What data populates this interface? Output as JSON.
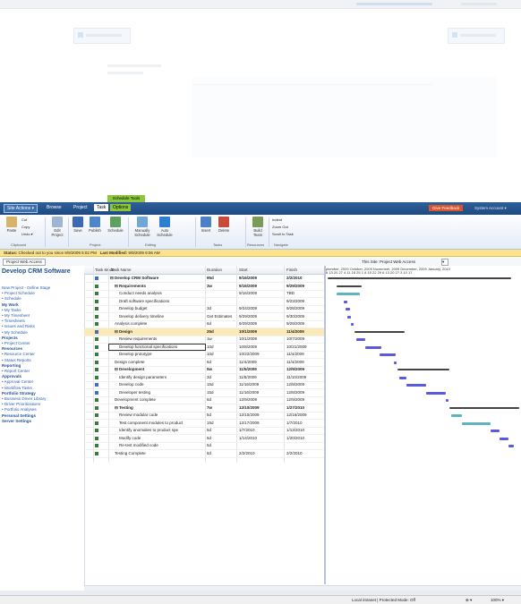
{
  "ribbon_tabs": {
    "site_actions": "Site Actions ▾",
    "browse": "Browse",
    "project": "Project",
    "task": "Task",
    "options": "Options",
    "context": "Schedule Tools",
    "feedback": "Give Feedback",
    "system": "System Account ▾"
  },
  "ribbon": {
    "paste": "Paste",
    "cut": "Cut",
    "copy": "Copy",
    "undo": "Undo ▾",
    "edit": "Edit Project",
    "save": "Save",
    "publish": "Publish",
    "schedule": "Schedule",
    "manual": "Manually Schedule",
    "auto": "Auto Schedule",
    "insert": "Insert",
    "delete": "Delete",
    "build_team": "Build Team",
    "indent": "Indent",
    "outdent": "Zoom Out",
    "scroll": "Scroll to Task",
    "groups": {
      "clipboard": "Clipboard",
      "project": "Project",
      "editing": "Editing",
      "tasks": "Tasks",
      "resources": "Resources",
      "navigate": "Navigate"
    }
  },
  "status": {
    "label": "Status:",
    "text": "Checked out to you since 9/9/2009 5:02 PM",
    "modified_label": "Last Modified:",
    "modified": "9/9/2009 9:06 AM"
  },
  "toolbar": {
    "project_web_access": "Project Web Access",
    "this_site": "This Site: Project Web Access",
    "search_value": "",
    "dropdown": "▾"
  },
  "leftnav": {
    "title": "Develop CRM Software",
    "items": [
      {
        "label": "New Project - Define Stage",
        "h": false
      },
      {
        "label": "• Project Schedule",
        "h": false
      },
      {
        "label": "• Schedule",
        "h": false
      },
      {
        "label": "My Work",
        "h": true
      },
      {
        "label": "• My Tasks",
        "h": false
      },
      {
        "label": "• My Timesheet",
        "h": false
      },
      {
        "label": "• Timesheets",
        "h": false
      },
      {
        "label": "• Issues and Risks",
        "h": false
      },
      {
        "label": "• My Schedule",
        "h": false
      },
      {
        "label": "Projects",
        "h": true
      },
      {
        "label": "• Project Center",
        "h": false
      },
      {
        "label": "Resources",
        "h": true
      },
      {
        "label": "• Resource Center",
        "h": false
      },
      {
        "label": "• Status Reports",
        "h": false
      },
      {
        "label": "Reporting",
        "h": true
      },
      {
        "label": "• Report Center",
        "h": false
      },
      {
        "label": "Approvals",
        "h": true
      },
      {
        "label": "• Approval Center",
        "h": false
      },
      {
        "label": "• Workflow Tasks",
        "h": false
      },
      {
        "label": "Portfolio Strategy",
        "h": true
      },
      {
        "label": "• Business Driver Library",
        "h": false
      },
      {
        "label": "• Driver Prioritizations",
        "h": false
      },
      {
        "label": "• Portfolio Analyses",
        "h": false
      },
      {
        "label": "Personal Settings",
        "h": true
      },
      {
        "label": "Server Settings",
        "h": true
      }
    ]
  },
  "grid": {
    "headers": {
      "mode": "Task Mode",
      "name": "Task Name",
      "duration": "Duration",
      "start": "Start",
      "finish": "Finish"
    },
    "rows": [
      {
        "name": "⊟ Develop CRM Software",
        "indent": 0,
        "dur": "95d",
        "start": "9/16/2009",
        "finish": "2/2/2010",
        "bold": true,
        "icon": "b"
      },
      {
        "name": "⊟ Requirements",
        "indent": 1,
        "dur": "3w",
        "start": "9/16/2009",
        "finish": "9/29/2009",
        "bold": true,
        "icon": "g"
      },
      {
        "name": "Conduct needs analysis",
        "indent": 2,
        "dur": "",
        "start": "9/16/2009",
        "finish": "TBD",
        "bold": false,
        "icon": "g"
      },
      {
        "name": "Draft software specifications",
        "indent": 2,
        "dur": "",
        "start": "",
        "finish": "9/23/2009",
        "bold": false,
        "icon": "g"
      },
      {
        "name": "Develop budget",
        "indent": 2,
        "dur": "3d",
        "start": "9/24/2009",
        "finish": "9/28/2009",
        "bold": false,
        "icon": "g"
      },
      {
        "name": "Develop delivery timeline",
        "indent": 2,
        "dur": "Get Estimates",
        "start": "9/29/2009",
        "finish": "9/30/2009",
        "bold": false,
        "icon": "g"
      },
      {
        "name": "Analysis complete",
        "indent": 1,
        "dur": "6d",
        "start": "9/29/2009",
        "finish": "9/29/2009",
        "bold": false,
        "icon": "g"
      },
      {
        "name": "⊟ Design",
        "indent": 1,
        "dur": "25d",
        "start": "10/1/2009",
        "finish": "11/4/2009",
        "bold": true,
        "icon": "b",
        "selbg": true
      },
      {
        "name": "Review requirements",
        "indent": 2,
        "dur": "1w",
        "start": "10/1/2009",
        "finish": "10/7/2009",
        "bold": false,
        "icon": "g"
      },
      {
        "name": "Develop functional specifications",
        "indent": 2,
        "dur": "10d",
        "start": "10/8/2009",
        "finish": "10/21/2009",
        "bold": false,
        "icon": "g",
        "sel": true
      },
      {
        "name": "Develop prototype",
        "indent": 2,
        "dur": "10d",
        "start": "10/22/2009",
        "finish": "11/4/2009",
        "bold": false,
        "icon": "g"
      },
      {
        "name": "Design complete",
        "indent": 1,
        "dur": "6d",
        "start": "11/4/2009",
        "finish": "11/4/2009",
        "bold": false,
        "icon": "g"
      },
      {
        "name": "⊟ Development",
        "indent": 1,
        "dur": "5w",
        "start": "11/5/2009",
        "finish": "12/9/2009",
        "bold": true,
        "icon": "g"
      },
      {
        "name": "Identify design parameters",
        "indent": 2,
        "dur": "3d",
        "start": "11/5/2009",
        "finish": "11/10/2009",
        "bold": false,
        "icon": "g"
      },
      {
        "name": "Develop code",
        "indent": 2,
        "dur": "15d",
        "start": "11/16/2009",
        "finish": "12/8/2009",
        "bold": false,
        "icon": "b"
      },
      {
        "name": "Developer testing",
        "indent": 2,
        "dur": "15d",
        "start": "11/16/2009",
        "finish": "12/8/2009",
        "bold": false,
        "icon": "b"
      },
      {
        "name": "Development complete",
        "indent": 1,
        "dur": "6d",
        "start": "12/9/2009",
        "finish": "12/9/2009",
        "bold": false,
        "icon": "g"
      },
      {
        "name": "⊟ Testing",
        "indent": 1,
        "dur": "7w",
        "start": "12/10/2009",
        "finish": "1/27/2010",
        "bold": true,
        "icon": "g"
      },
      {
        "name": "Review modular code",
        "indent": 2,
        "dur": "5d",
        "start": "12/10/2009",
        "finish": "12/16/2009",
        "bold": false,
        "icon": "g"
      },
      {
        "name": "Test component modules to product",
        "indent": 2,
        "dur": "15d",
        "start": "12/17/2009",
        "finish": "1/7/2010",
        "bold": false,
        "icon": "g"
      },
      {
        "name": "Identify anomalies to product spe",
        "indent": 2,
        "dur": "5d",
        "start": "1/7/2010",
        "finish": "1/13/2010",
        "bold": false,
        "icon": "g"
      },
      {
        "name": "Modify code",
        "indent": 2,
        "dur": "5d",
        "start": "1/14/2010",
        "finish": "1/20/2010",
        "bold": false,
        "icon": "g"
      },
      {
        "name": "Re-test modified code",
        "indent": 2,
        "dur": "5d",
        "start": "",
        "finish": "",
        "bold": false,
        "icon": "g"
      },
      {
        "name": "Testing Complete",
        "indent": 1,
        "dur": "6d",
        "start": "2/2/2010",
        "finish": "2/2/2010",
        "bold": false,
        "icon": "g"
      }
    ]
  },
  "gantt": {
    "months": "ptember, 2009  October, 2009     November, 2009   December, 2009   January, 2010",
    "days": " 6  13  20  27  4   11  18  25  1   8   15  22  29  6   13  20  27  3   10  17"
  },
  "statusbar": {
    "zone": "Local intranet | Protected Mode: Off",
    "ie": "⊕ ▾",
    "zoom": "100% ▾"
  },
  "colors": {
    "ribbon": "#1f4a80",
    "context": "#8cc63f",
    "feedback": "#d9532c",
    "status": "#ffe38a",
    "task_bar": "#5a5ae0"
  }
}
